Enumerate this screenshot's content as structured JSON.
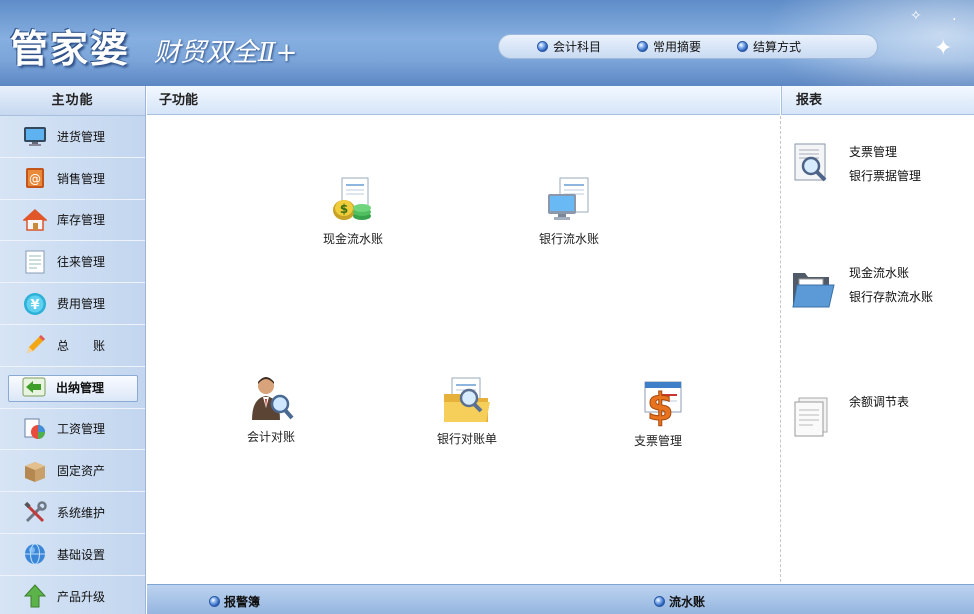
{
  "header": {
    "logo_main": "管家婆",
    "logo_sub": "财贸双全Ⅱ+",
    "top_links": [
      {
        "label": "会计科目"
      },
      {
        "label": "常用摘要"
      },
      {
        "label": "结算方式"
      }
    ]
  },
  "sidebar": {
    "title": "主功能",
    "active_index": 6,
    "items": [
      {
        "label": "进货管理",
        "icon": "monitor-icon"
      },
      {
        "label": "销售管理",
        "icon": "email-book-icon"
      },
      {
        "label": "库存管理",
        "icon": "house-icon"
      },
      {
        "label": "往来管理",
        "icon": "document-icon"
      },
      {
        "label": "费用管理",
        "icon": "yen-coin-icon"
      },
      {
        "label": "总　　账",
        "icon": "pencil-icon"
      },
      {
        "label": "出纳管理",
        "icon": "arrow-left-icon"
      },
      {
        "label": "工资管理",
        "icon": "chart-pie-icon"
      },
      {
        "label": "固定资产",
        "icon": "box-icon"
      },
      {
        "label": "系统维护",
        "icon": "tools-icon"
      },
      {
        "label": "基础设置",
        "icon": "globe-icon"
      },
      {
        "label": "产品升级",
        "icon": "up-arrow-icon"
      }
    ]
  },
  "subfunctions": {
    "title": "子功能",
    "items": [
      {
        "label": "现金流水账",
        "icon": "cash-icon"
      },
      {
        "label": "银行流水账",
        "icon": "bank-computer-icon"
      },
      {
        "label": "会计对账",
        "icon": "accountant-search-icon"
      },
      {
        "label": "银行对账单",
        "icon": "folder-search-icon"
      },
      {
        "label": "支票管理",
        "icon": "dollar-check-icon"
      }
    ]
  },
  "reports": {
    "title": "报表",
    "groups": [
      {
        "icon": "report-search-icon",
        "links": [
          "支票管理",
          "银行票据管理"
        ]
      },
      {
        "icon": "open-folder-icon",
        "links": [
          "现金流水账",
          "银行存款流水账"
        ]
      },
      {
        "icon": "pages-icon",
        "links": [
          "余额调节表"
        ]
      }
    ]
  },
  "footer": {
    "left_label": "报警簿",
    "right_label": "流水账"
  },
  "colors": {
    "header_blue": "#6f9ad2",
    "panel_blue": "#c3d6ef",
    "accent": "#1f55b3"
  }
}
